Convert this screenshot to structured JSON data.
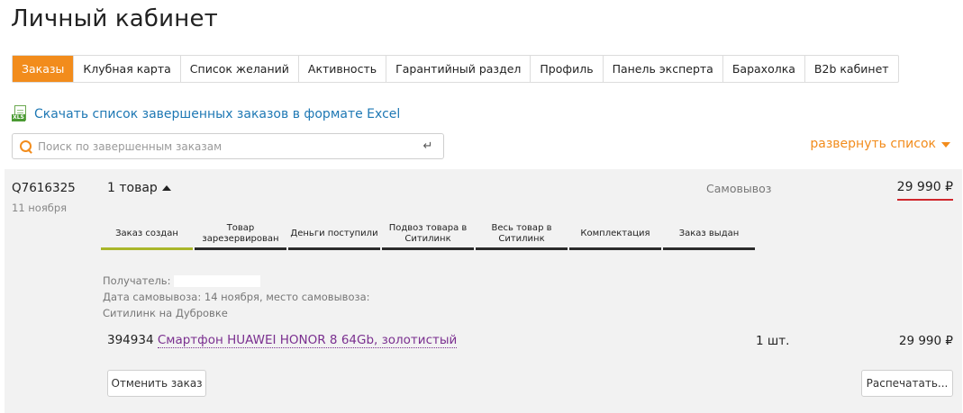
{
  "page_title": "Личный кабинет",
  "tabs": [
    {
      "label": "Заказы",
      "active": true
    },
    {
      "label": "Клубная карта",
      "active": false
    },
    {
      "label": "Список желаний",
      "active": false
    },
    {
      "label": "Активность",
      "active": false
    },
    {
      "label": "Гарантийный раздел",
      "active": false
    },
    {
      "label": "Профиль",
      "active": false
    },
    {
      "label": "Панель эксперта",
      "active": false
    },
    {
      "label": "Барахолка",
      "active": false
    },
    {
      "label": "B2b кабинет",
      "active": false
    }
  ],
  "excel_link": "Скачать список завершенных заказов в формате Excel",
  "excel_icon": "XLS",
  "search": {
    "placeholder": "Поиск по завершенным заказам",
    "value": ""
  },
  "expand_label": "развернуть список",
  "order": {
    "id": "Q7616325",
    "date": "11 ноября",
    "items_label": "1 товар",
    "delivery": "Самовывоз",
    "total": "29 990 ₽",
    "steps": [
      {
        "label": "Заказ создан",
        "done": true
      },
      {
        "label": "Товар зарезервирован",
        "done": false
      },
      {
        "label": "Деньги поступили",
        "done": false
      },
      {
        "label": "Подвоз товара в Ситилинк",
        "done": false
      },
      {
        "label": "Весь товар в Ситилинк",
        "done": false
      },
      {
        "label": "Комплектация",
        "done": false
      },
      {
        "label": "Заказ выдан",
        "done": false
      }
    ],
    "recipient_label": "Получатель:",
    "pickup_line1": "Дата самовывоза: 14 ноября, место самовывоза:",
    "pickup_line2": "Ситилинк на Дубровке",
    "product": {
      "code": "394934",
      "name": "Смартфон HUAWEI HONOR 8 64Gb, золотистый",
      "qty": "1 шт.",
      "price": "29 990 ₽"
    },
    "cancel_label": "Отменить заказ",
    "print_label": "Распечатать..."
  },
  "colors": {
    "accent": "#f28c1c",
    "link": "#1e78b4",
    "product_link": "#7a2f8f",
    "total_underline": "#d0262c",
    "step_done": "#a9b62a"
  }
}
